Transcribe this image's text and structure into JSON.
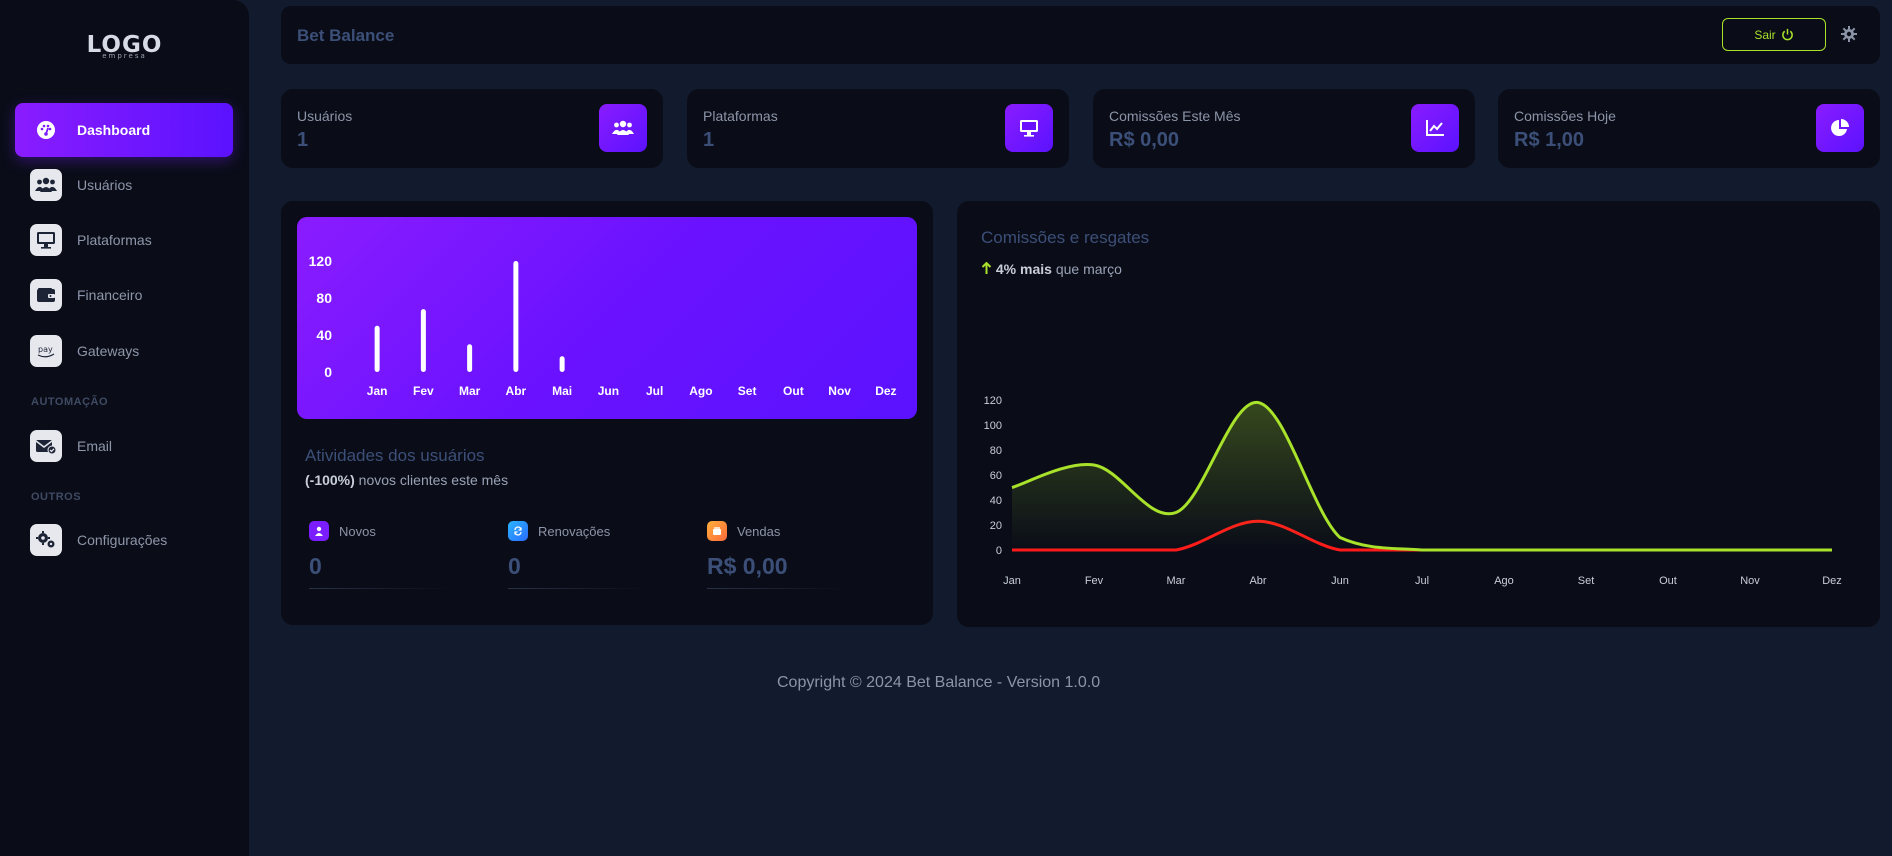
{
  "sidebar": {
    "logo": "LOGO",
    "logo_sub": "empresa",
    "items": [
      {
        "label": "Dashboard",
        "icon": "dashboard-icon",
        "active": true
      },
      {
        "label": "Usuários",
        "icon": "users-icon"
      },
      {
        "label": "Plataformas",
        "icon": "monitor-icon"
      },
      {
        "label": "Financeiro",
        "icon": "wallet-icon"
      },
      {
        "label": "Gateways",
        "icon": "pay-icon"
      }
    ],
    "section_automacao": "AUTOMAÇÃO",
    "email_label": "Email",
    "section_outros": "OUTROS",
    "config_label": "Configurações"
  },
  "header": {
    "title": "Bet Balance",
    "logout_label": "Sair",
    "accent": "#a8e22a"
  },
  "stats": [
    {
      "label": "Usuários",
      "value": "1",
      "icon": "users-icon"
    },
    {
      "label": "Plataformas",
      "value": "1",
      "icon": "monitor-icon"
    },
    {
      "label": "Comissões Este Mês",
      "value": "R$ 0,00",
      "icon": "line-chart-icon"
    },
    {
      "label": "Comissões Hoje",
      "value": "R$ 1,00",
      "icon": "pie-chart-icon"
    }
  ],
  "activity": {
    "title": "Atividades dos usuários",
    "sub_bold": "(-100%)",
    "sub_rest": " novos clientes este mês",
    "items": [
      {
        "label": "Novos",
        "value": "0",
        "color": "#7a1dff"
      },
      {
        "label": "Renovações",
        "value": "0",
        "color": "#2a8cff"
      },
      {
        "label": "Vendas",
        "value": "R$ 0,00",
        "color": "#ff8a3a"
      }
    ]
  },
  "commissions": {
    "title": "Comissões e resgates",
    "sub_bold": "4% mais",
    "sub_rest": " que março",
    "series_colors": [
      "#a8e22a",
      "#ff1a1a"
    ]
  },
  "footer": {
    "text": "Copyright © 2024 Bet Balance - Version 1.0.0"
  },
  "chart_data": [
    {
      "type": "bar",
      "categories": [
        "Jan",
        "Fev",
        "Mar",
        "Abr",
        "Mai",
        "Jun",
        "Jul",
        "Ago",
        "Set",
        "Out",
        "Nov",
        "Dez"
      ],
      "values": [
        50,
        68,
        30,
        120,
        17,
        0,
        0,
        0,
        0,
        0,
        0,
        0
      ],
      "yticks": [
        0,
        40,
        80,
        120
      ],
      "ylim": [
        0,
        120
      ],
      "grid": false
    },
    {
      "type": "line",
      "categories": [
        "Jan",
        "Fev",
        "Mar",
        "Abr",
        "Jun",
        "Jul",
        "Ago",
        "Set",
        "Out",
        "Nov",
        "Dez"
      ],
      "series": [
        {
          "values": [
            50,
            68,
            30,
            118,
            10,
            0,
            0,
            0,
            0,
            0,
            0
          ]
        },
        {
          "values": [
            0,
            0,
            0,
            23,
            0,
            0,
            0,
            0,
            0,
            0,
            0
          ]
        }
      ],
      "yticks": [
        0,
        20,
        40,
        60,
        80,
        100,
        120
      ],
      "ylim": [
        0,
        130
      ],
      "grid": false
    }
  ]
}
